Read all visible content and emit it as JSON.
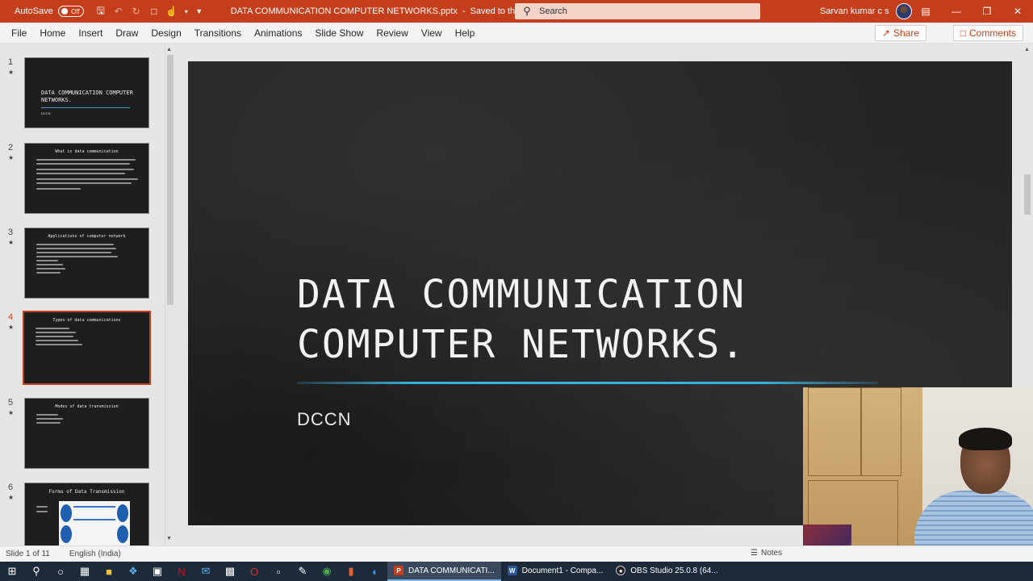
{
  "titlebar": {
    "autosave_label": "AutoSave",
    "autosave_state": "Off",
    "doc_title": "DATA COMMUNICATION COMPUTER NETWORKS.pptx",
    "save_status": "Saved to this PC",
    "search_placeholder": "Search",
    "user_name": "Sarvan kumar c s",
    "bg_color": "#c43e1c"
  },
  "menu": {
    "items": [
      "File",
      "Home",
      "Insert",
      "Draw",
      "Design",
      "Transitions",
      "Animations",
      "Slide Show",
      "Review",
      "View",
      "Help"
    ],
    "share_label": "Share",
    "comments_label": "Comments"
  },
  "thumbnails": [
    {
      "num": "1",
      "title": "DATA COMMUNICATION COMPUTER NETWORKS.",
      "sub": "DCCN"
    },
    {
      "num": "2",
      "title": "What is data communication"
    },
    {
      "num": "3",
      "title": "Applications of computer network"
    },
    {
      "num": "4",
      "title": "Types of data communications"
    },
    {
      "num": "5",
      "title": "Modes of data transmission"
    },
    {
      "num": "6",
      "title": "Forms of Data Transmission"
    }
  ],
  "active_slide_index": 4,
  "slide": {
    "title_line1": "DATA COMMUNICATION",
    "title_line2": "COMPUTER NETWORKS.",
    "subtitle": "DCCN"
  },
  "statusbar": {
    "slide_info": "Slide 1 of 11",
    "language": "English (India)",
    "notes_label": "Notes"
  },
  "taskbar": {
    "apps": [
      {
        "label": "DATA COMMUNICATI...",
        "badge": "P",
        "color": "#c43e1c",
        "active": true
      },
      {
        "label": "Document1 - Compa...",
        "badge": "W",
        "color": "#2b5797",
        "active": false
      },
      {
        "label": "OBS Studio 25.0.8 (64...",
        "badge": "●",
        "color": "#222222",
        "active": false
      }
    ]
  }
}
